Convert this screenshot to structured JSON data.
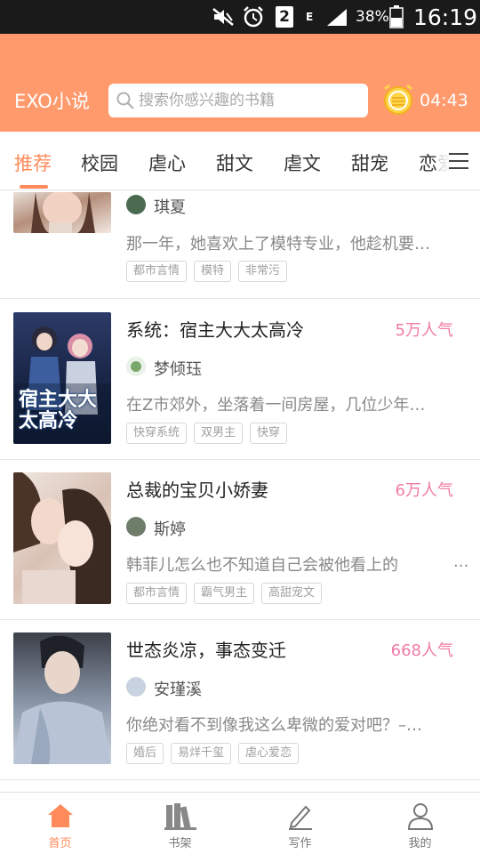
{
  "status_bar": {
    "battery_text": "38%",
    "sim": "2",
    "data": "E",
    "time": "16:19"
  },
  "header": {
    "app_title": "EXO小说",
    "search_placeholder": "搜索你感兴趣的书籍",
    "timer": "04:43",
    "accent_color": "#ff9a6c"
  },
  "tabs": [
    "推荐",
    "校园",
    "虐心",
    "甜文",
    "虐文",
    "甜宠",
    "恋爱"
  ],
  "books": [
    {
      "title": "",
      "popularity": "",
      "author": "琪夏",
      "desc": "那一年，她喜欢上了模特专业，他趁机要…",
      "tags": [
        "都市言情",
        "模特",
        "非常污"
      ]
    },
    {
      "title": "系统：宿主大大太高冷",
      "popularity": "5万人气",
      "author": "梦倾珏",
      "desc": "在Z市郊外，坐落着一间房屋，几位少年…",
      "tags": [
        "快穿系统",
        "双男主",
        "快穿"
      ],
      "cover_text": "宿主大大太高冷"
    },
    {
      "title": "总裁的宝贝小娇妻",
      "popularity": "6万人气",
      "author": "斯婷",
      "desc": "韩菲儿怎么也不知道自己会被他看上的",
      "desc_ellipsis": "...",
      "tags": [
        "都市言情",
        "霸气男主",
        "高甜宠文"
      ]
    },
    {
      "title": "世态炎凉，事态变迁",
      "popularity": "668人气",
      "author": "安瑾溪",
      "desc": "你绝对看不到像我这么卑微的爱对吧？–…",
      "tags": [
        "婚后",
        "易烊千玺",
        "虐心爱恋"
      ]
    }
  ],
  "bottom_nav": [
    "首页",
    "书架",
    "写作",
    "我的"
  ]
}
